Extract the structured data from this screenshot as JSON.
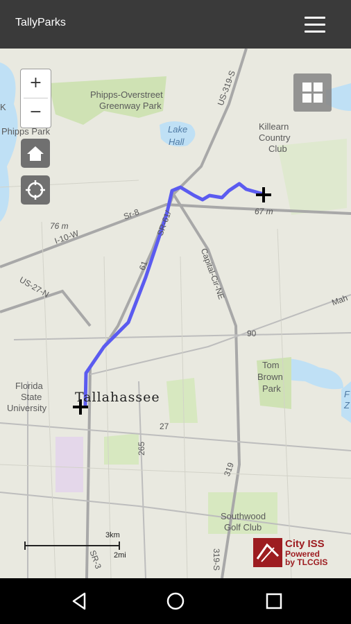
{
  "app": {
    "title": "TallyParks"
  },
  "map": {
    "zoom_in_label": "+",
    "zoom_out_label": "−",
    "labels": {
      "phipps_overstreet": "Phipps-Overstreet",
      "greenway_park": "Greenway Park",
      "phipps_park": "Phipps Park",
      "lake_hall_1": "Lake",
      "lake_hall_2": "Hall",
      "killearn_1": "Killearn",
      "killearn_2": "Country",
      "killearn_3": "Club",
      "us_319": "US-319-S",
      "sr8": "Sr-8",
      "i10w": "I-10-W",
      "elev_76": "76 m",
      "elev_67": "67 m",
      "us_27_n": "US-27-N",
      "sr_61": "SR-61/",
      "capital_cir": "Capital-Cir-NE",
      "num_61": "61",
      "num_90": "90",
      "mah": "Mah",
      "tom_brown_1": "Tom",
      "tom_brown_2": "Brown",
      "tom_brown_3": "Park",
      "fsu_1": "Florida",
      "fsu_2": "State",
      "fsu_3": "University",
      "city": "Tallahassee",
      "num_27": "27",
      "num_265": "265",
      "num_319": "319",
      "southwood_1": "Southwood",
      "southwood_2": "Golf Club",
      "sr_3": "SR-3",
      "num_319_s": "319-S",
      "edge_f": "F",
      "edge_z": "Z",
      "edge_k": "K"
    },
    "scale": {
      "km": "3km",
      "mi": "2mi"
    },
    "logo": {
      "line1": "City ISS",
      "line2": "Powered",
      "line3": "by TLCGIS"
    },
    "colors": {
      "route": "#5b5bf0",
      "water": "#bfe0f5",
      "park": "#cfe2b4",
      "road": "#a8a8a8"
    }
  }
}
